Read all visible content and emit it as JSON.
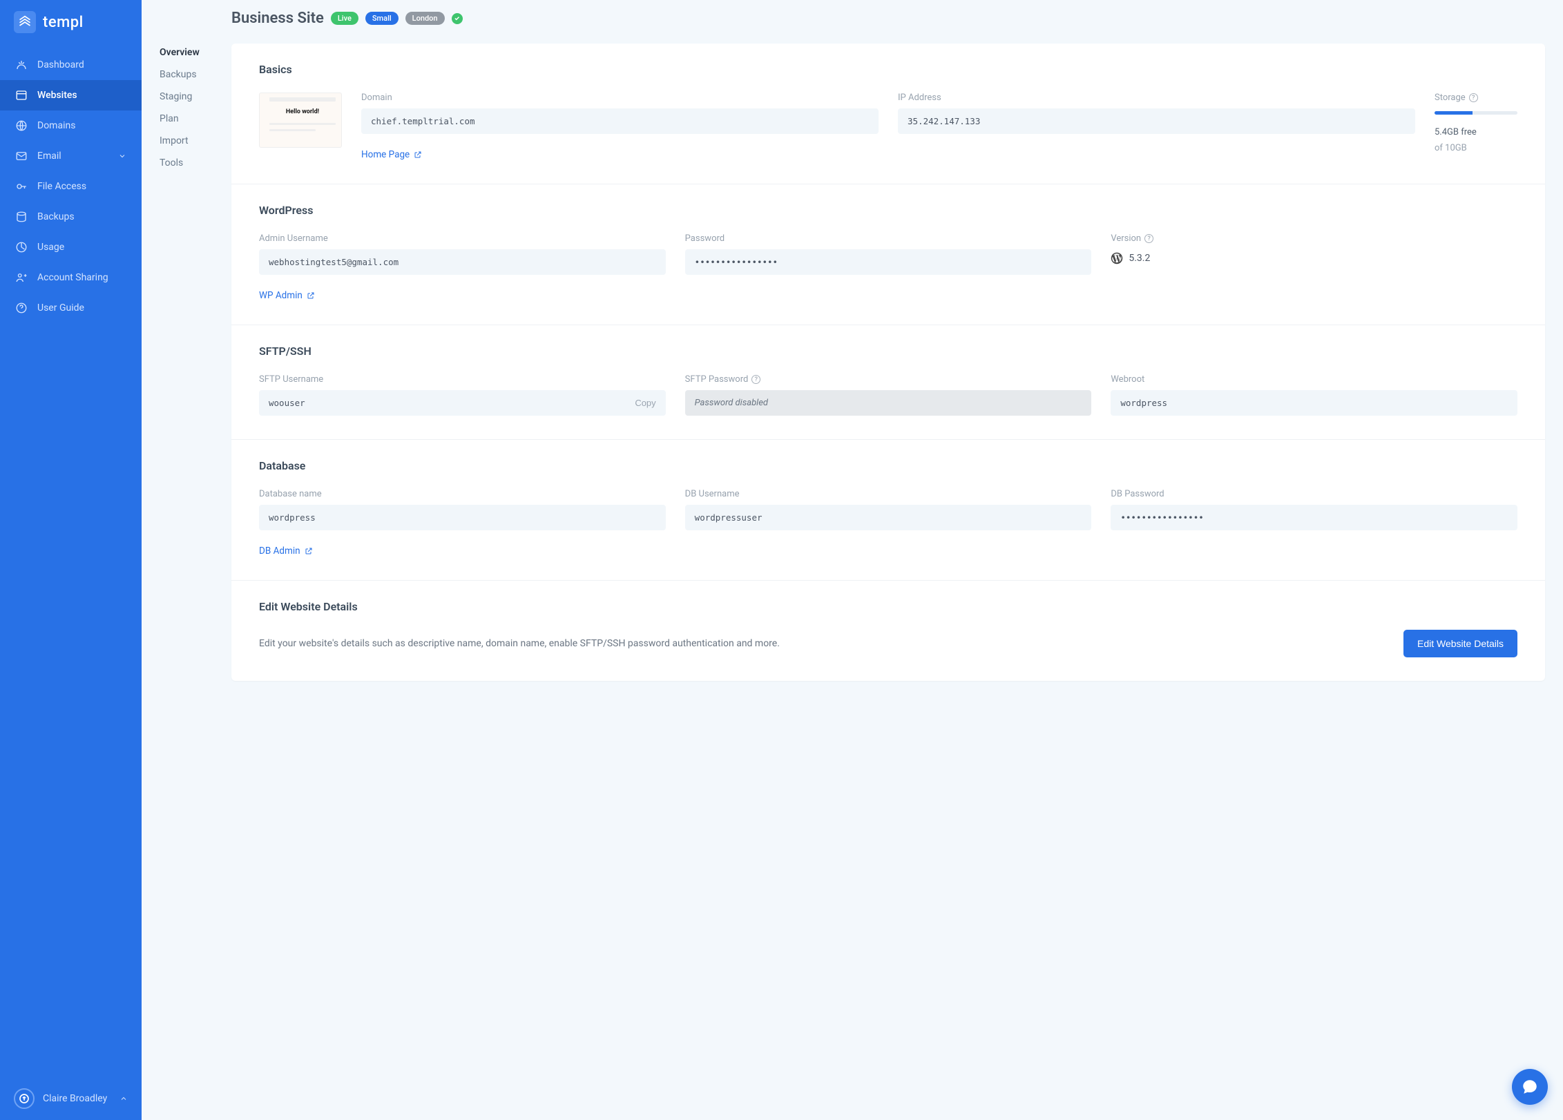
{
  "brand": "templ",
  "sidebar": {
    "items": [
      {
        "label": "Dashboard"
      },
      {
        "label": "Websites"
      },
      {
        "label": "Domains"
      },
      {
        "label": "Email"
      },
      {
        "label": "File Access"
      },
      {
        "label": "Backups"
      },
      {
        "label": "Usage"
      },
      {
        "label": "Account Sharing"
      },
      {
        "label": "User Guide"
      }
    ]
  },
  "subnav": {
    "items": [
      {
        "label": "Overview"
      },
      {
        "label": "Backups"
      },
      {
        "label": "Staging"
      },
      {
        "label": "Plan"
      },
      {
        "label": "Import"
      },
      {
        "label": "Tools"
      }
    ]
  },
  "header": {
    "title": "Business Site",
    "badges": {
      "live": "Live",
      "size": "Small",
      "region": "London"
    }
  },
  "basics": {
    "title": "Basics",
    "thumb_text": "Hello world!",
    "domain_label": "Domain",
    "domain_value": "chief.templtrial.com",
    "ip_label": "IP Address",
    "ip_value": "35.242.147.133",
    "storage_label": "Storage",
    "storage_free": "5.4GB free",
    "storage_of": "of 10GB",
    "home_link": "Home Page"
  },
  "wordpress": {
    "title": "WordPress",
    "admin_user_label": "Admin Username",
    "admin_user_value": "webhostingtest5@gmail.com",
    "password_label": "Password",
    "password_value": "••••••••••••••••",
    "version_label": "Version",
    "version_value": "5.3.2",
    "wp_admin_link": "WP Admin"
  },
  "sftp": {
    "title": "SFTP/SSH",
    "user_label": "SFTP Username",
    "user_value": "woouser",
    "copy_label": "Copy",
    "password_label": "SFTP Password",
    "password_value": "Password disabled",
    "webroot_label": "Webroot",
    "webroot_value": "wordpress"
  },
  "database": {
    "title": "Database",
    "name_label": "Database name",
    "name_value": "wordpress",
    "user_label": "DB Username",
    "user_value": "wordpressuser",
    "password_label": "DB Password",
    "password_value": "••••••••••••••••",
    "admin_link": "DB Admin"
  },
  "edit": {
    "title": "Edit Website Details",
    "desc": "Edit your website's details such as descriptive name, domain name, enable SFTP/SSH password authentication and more.",
    "button": "Edit Website Details"
  },
  "user": {
    "name": "Claire Broadley"
  }
}
